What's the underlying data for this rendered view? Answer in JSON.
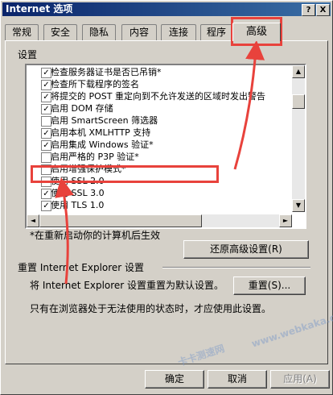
{
  "window": {
    "title": "Internet 选项"
  },
  "title_buttons": [
    "?",
    "X"
  ],
  "tabs": [
    "常规",
    "安全",
    "隐私",
    "内容",
    "连接",
    "程序",
    "高级"
  ],
  "section_label": "设置",
  "settings": [
    {
      "label": "检查服务器证书是否已吊销*",
      "checked": true
    },
    {
      "label": "检查所下载程序的签名",
      "checked": true
    },
    {
      "label": "将提交的 POST 重定向到不允许发送的区域时发出警告",
      "checked": true
    },
    {
      "label": "启用 DOM 存储",
      "checked": true
    },
    {
      "label": "启用 SmartScreen 筛选器",
      "checked": false
    },
    {
      "label": "启用本机 XMLHTTP 支持",
      "checked": true
    },
    {
      "label": "启用集成 Windows 验证*",
      "checked": true
    },
    {
      "label": "启用严格的 P3P 验证*",
      "checked": false
    },
    {
      "label": "启用增强保护模式*",
      "checked": false
    },
    {
      "label": "使用 SSL 2.0",
      "checked": false
    },
    {
      "label": "使用 SSL 3.0",
      "checked": true
    },
    {
      "label": "使用 TLS 1.0",
      "checked": true
    }
  ],
  "restart_note": "*在重新启动你的计算机后生效",
  "restore_button": "还原高级设置(R)",
  "reset_group": {
    "title": "重置 Internet Explorer 设置",
    "description": "将 Internet Explorer 设置重置为默认设置。",
    "button": "重置(S)...",
    "note": "只有在浏览器处于无法使用的状态时，才应使用此设置。"
  },
  "footer": {
    "ok": "确定",
    "cancel": "取消",
    "apply": "应用(A)"
  },
  "watermark": "www.webkaka.com",
  "watermark2": "卡卡测速网",
  "colors": {
    "highlight": "#e8423c",
    "titlebar": "#0a246a"
  }
}
